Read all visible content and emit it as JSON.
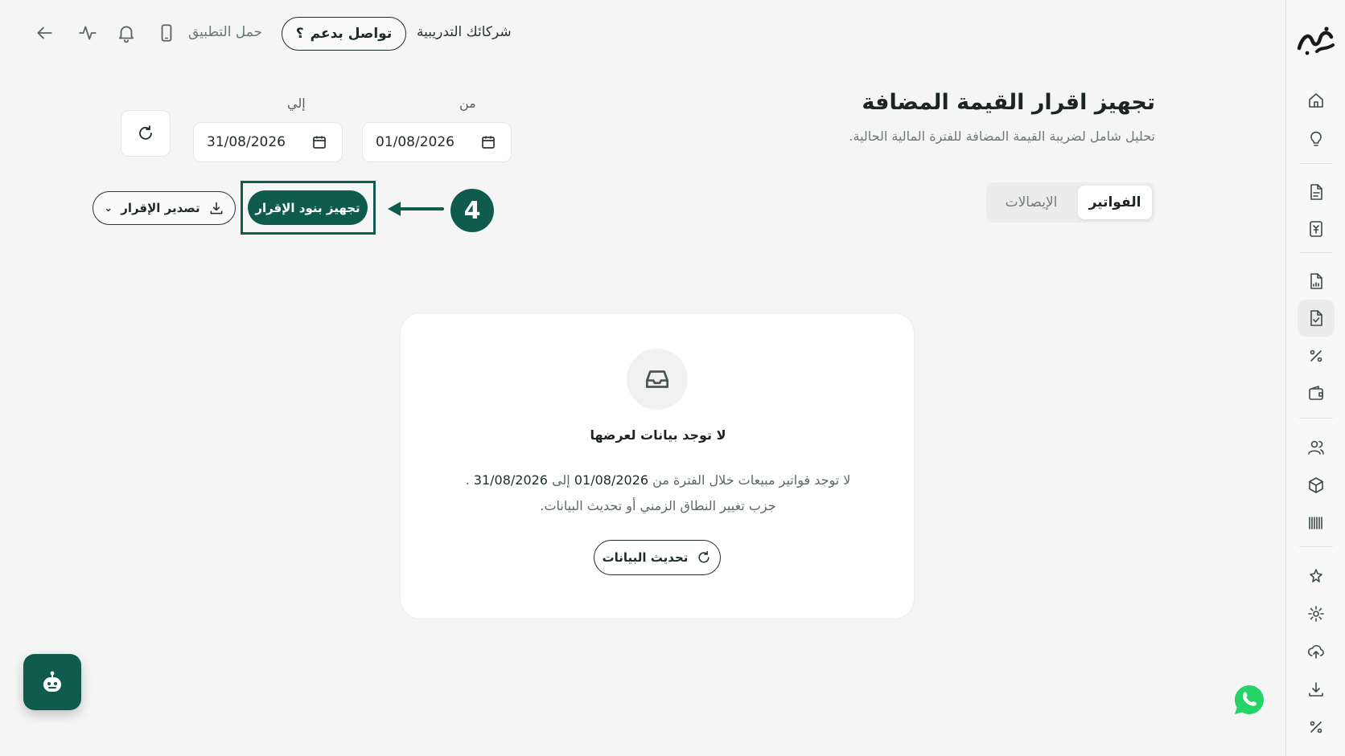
{
  "topbar": {
    "company": "شركائك التدريبية",
    "support_label": "تواصل بدعم",
    "download_app": "حمل التطبيق",
    "icons": [
      "back-arrow-icon",
      "activity-icon",
      "bell-icon",
      "phone-icon",
      "help-icon"
    ]
  },
  "header": {
    "title": "تجهيز اقرار القيمة المضافة",
    "subtitle": "تحليل شامل لضريبة القيمة المضافة للفترة المالية الحالية."
  },
  "tabs": [
    {
      "label": "الفواتير",
      "active": true
    },
    {
      "label": "الإيصالات",
      "active": false
    }
  ],
  "dates": {
    "from_label": "من",
    "from_value": "01/08/2026",
    "to_label": "إلي",
    "to_value": "31/08/2026"
  },
  "actions": {
    "prepare": "تجهيز بنود الإقرار",
    "export": "تصدير الإقرار",
    "step_number": "4"
  },
  "empty_state": {
    "title": "لا توجد بيانات لعرضها",
    "msg_prefix": "لا توجد فواتير مبيعات خلال الفترة من",
    "msg_from": "01/08/2026",
    "msg_to_word": "إلى",
    "msg_to": "31/08/2026",
    "msg_end": ".",
    "msg_line2": "جزب تغيير النطاق الزمني أو تحديث البيانات.",
    "update_button": "تحديث البيانات"
  },
  "sidebar": {
    "icons": [
      "home-icon",
      "lightbulb-icon",
      "document-icon",
      "receipt-icon",
      "file-chart-icon",
      "file-check-icon",
      "percent-icon",
      "wallet-icon",
      "users-icon",
      "box-icon",
      "barcode-icon",
      "settings-star-icon",
      "gear-icon",
      "cloud-upload-icon",
      "download-icon",
      "percent-icon"
    ],
    "active_index": 5
  },
  "colors": {
    "primary": "#0f5c4e",
    "background": "#f5f5f5",
    "whatsapp": "#25d366"
  }
}
